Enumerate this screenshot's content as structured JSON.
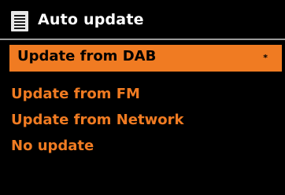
{
  "header": {
    "title": "Auto update",
    "icon": "list-icon"
  },
  "menu": {
    "items": [
      {
        "label": "Update from DAB",
        "selected": true,
        "mark": "*"
      },
      {
        "label": "Update from FM",
        "selected": false
      },
      {
        "label": "Update from Network",
        "selected": false
      },
      {
        "label": "No update",
        "selected": false
      }
    ]
  },
  "colors": {
    "background": "#000000",
    "accent": "#f07b22",
    "title_text": "#ffffff",
    "selected_text": "#000000"
  }
}
